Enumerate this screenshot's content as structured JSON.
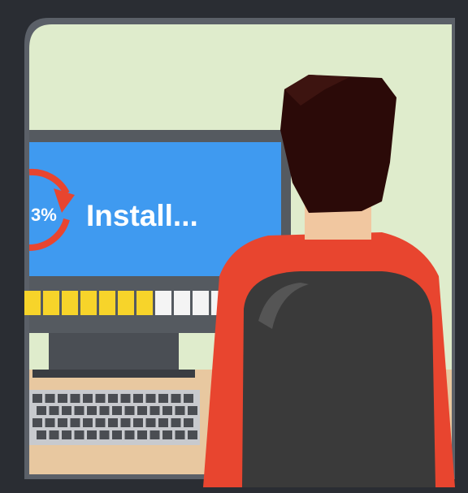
{
  "screen": {
    "percent_label": "3%",
    "status_label": "Install..."
  },
  "progress": {
    "filled_segments": 7,
    "total_segments": 11,
    "fraction": 0.64
  },
  "colors": {
    "wall": "#dfeccc",
    "screen": "#3f9af0",
    "monitor_frame": "#555a60",
    "progress_fill": "#f7d42a",
    "progress_empty": "#f4f4f4",
    "spinner": "#e8452f",
    "shirt": "#e8452f",
    "hair": "#2b0a08",
    "chair": "#3a3a3a",
    "desk": "#e8c8a0"
  },
  "icons": {
    "spinner": "refresh-arrows-icon"
  }
}
